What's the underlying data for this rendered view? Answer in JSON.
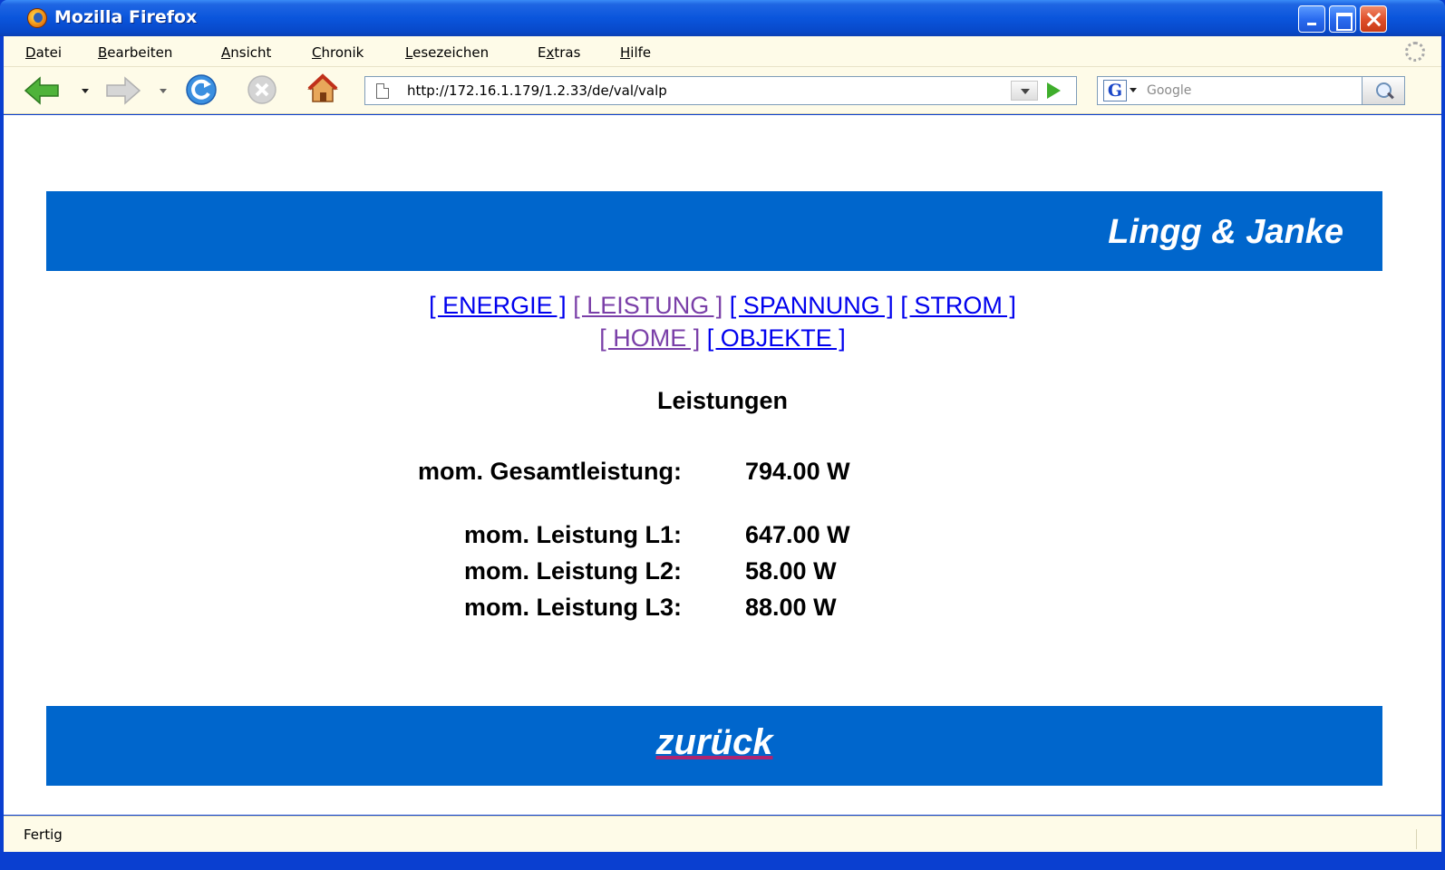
{
  "window": {
    "title": "Mozilla Firefox"
  },
  "menubar": {
    "items": [
      {
        "pre": "",
        "acc": "D",
        "post": "atei"
      },
      {
        "pre": "",
        "acc": "B",
        "post": "earbeiten"
      },
      {
        "pre": "",
        "acc": "A",
        "post": "nsicht"
      },
      {
        "pre": "",
        "acc": "C",
        "post": "hronik"
      },
      {
        "pre": "",
        "acc": "L",
        "post": "esezeichen"
      },
      {
        "pre": "E",
        "acc": "x",
        "post": "tras"
      },
      {
        "pre": "",
        "acc": "H",
        "post": "ilfe"
      }
    ]
  },
  "toolbar": {
    "url": "http://172.16.1.179/1.2.33/de/val/valp",
    "search_placeholder": "Google",
    "search_engine_letter": "G"
  },
  "page": {
    "brand": "Lingg & Janke",
    "nav_row1": [
      {
        "label": "[ ENERGIE ]",
        "visited": false
      },
      {
        "label": "[ LEISTUNG ]",
        "visited": true
      },
      {
        "label": "[ SPANNUNG ]",
        "visited": false
      },
      {
        "label": "[ STROM ]",
        "visited": false
      }
    ],
    "nav_row2": [
      {
        "label": "[ HOME ]",
        "visited": true
      },
      {
        "label": "[ OBJEKTE ]",
        "visited": false
      }
    ],
    "section_title": "Leistungen",
    "total": {
      "label": "mom. Gesamtleistung:",
      "value": "794.00 W"
    },
    "phases": [
      {
        "label": "mom. Leistung L1:",
        "value": "647.00 W"
      },
      {
        "label": "mom. Leistung L2:",
        "value": "58.00 W"
      },
      {
        "label": "mom. Leistung L3:",
        "value": "88.00 W"
      }
    ],
    "back_label": "zurück"
  },
  "status": {
    "text": "Fertig"
  },
  "colors": {
    "band": "#0066cc",
    "link": "#0000ee",
    "visited": "#7a3fa8",
    "chrome": "#fefbe8"
  }
}
